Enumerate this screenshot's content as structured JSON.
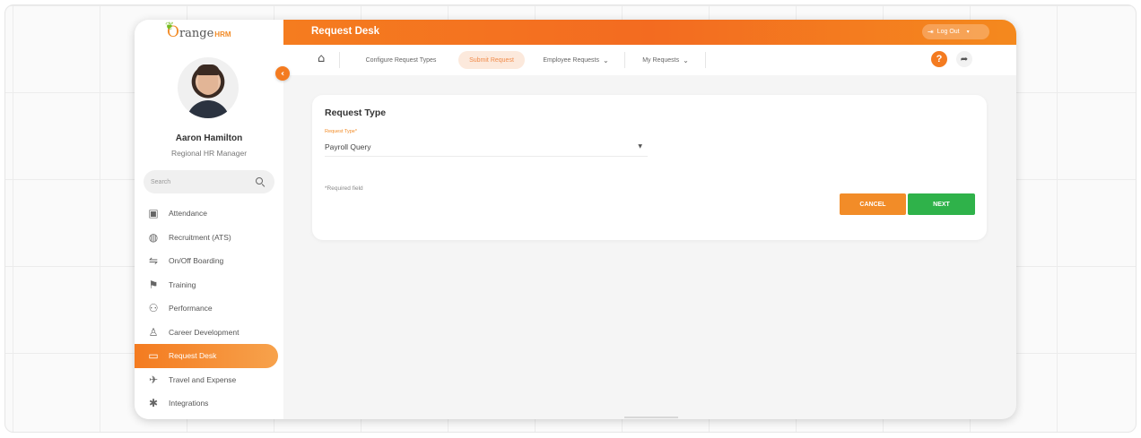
{
  "brand": {
    "logo_prefix": "O",
    "logo_text": "range",
    "logo_suffix": "HRM"
  },
  "user": {
    "name": "Aaron Hamilton",
    "role": "Regional HR Manager"
  },
  "sidebar": {
    "search_placeholder": "Search",
    "items": [
      {
        "label": "Attendance",
        "icon": "calendar-icon"
      },
      {
        "label": "Recruitment (ATS)",
        "icon": "chat-bubble-icon"
      },
      {
        "label": "On/Off Boarding",
        "icon": "handshake-icon"
      },
      {
        "label": "Training",
        "icon": "training-icon"
      },
      {
        "label": "Performance",
        "icon": "performance-icon"
      },
      {
        "label": "Career Development",
        "icon": "career-icon"
      },
      {
        "label": "Request Desk",
        "icon": "request-desk-icon",
        "active": true
      },
      {
        "label": "Travel and Expense",
        "icon": "plane-icon"
      },
      {
        "label": "Integrations",
        "icon": "gear-icon"
      }
    ]
  },
  "header": {
    "title": "Request Desk",
    "logout_label": "Log Out"
  },
  "nav": {
    "tabs": [
      {
        "label": "Configure Request Types",
        "active": false,
        "dropdown": false
      },
      {
        "label": "Submit Request",
        "active": true,
        "dropdown": false
      },
      {
        "label": "Employee Requests",
        "active": false,
        "dropdown": true
      },
      {
        "label": "My Requests",
        "active": false,
        "dropdown": true
      }
    ],
    "help_label": "?"
  },
  "form": {
    "title": "Request Type",
    "field_label": "Request Type*",
    "field_value": "Payroll Query",
    "required_note": "*Required field",
    "cancel_label": "CANCEL",
    "next_label": "NEXT"
  },
  "colors": {
    "accent": "#f47b20",
    "success": "#2fb24a"
  }
}
